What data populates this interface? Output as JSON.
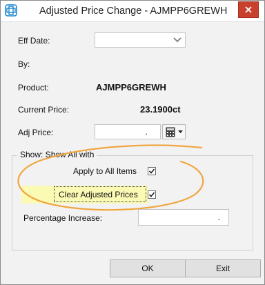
{
  "window": {
    "title": "Adjusted Price Change - AJMPP6GREWH"
  },
  "form": {
    "eff_date_label": "Eff Date:",
    "eff_date_value": "",
    "by_label": "By:",
    "product_label": "Product:",
    "product_value": "AJMPP6GREWH",
    "current_price_label": "Current Price:",
    "current_price_value": "23.1900ct",
    "adj_price_label": "Adj Price:",
    "adj_price_value": ".",
    "show_group_label": "Show: Show All with",
    "apply_all_label": "Apply to All Items",
    "apply_all_checked": true,
    "clear_adjusted_label": "Clear Adjusted Prices",
    "clear_adjusted_checked": true,
    "percentage_label": "Percentage Increase:",
    "percentage_value": "."
  },
  "buttons": {
    "ok_label": "OK",
    "exit_label": "Exit"
  },
  "colors": {
    "close_button": "#c7412d",
    "highlight": "#fbfab4",
    "annotation": "#f0a640",
    "app_icon": "#1e88d2"
  },
  "icons": {
    "app": "app-logo-icon",
    "close": "close-icon",
    "dropdown": "chevron-down-icon",
    "calculator": "calculator-icon"
  }
}
